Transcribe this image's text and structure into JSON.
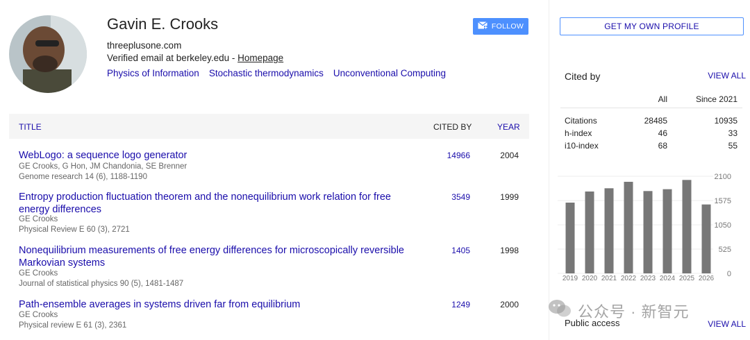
{
  "profile": {
    "name": "Gavin E. Crooks",
    "affiliation": "threeplusone.com",
    "email_text": "Verified email at berkeley.edu - ",
    "homepage_label": "Homepage",
    "interests": [
      "Physics of Information",
      "Stochastic thermodynamics",
      "Unconventional Computing"
    ],
    "follow_label": "FOLLOW"
  },
  "table": {
    "headers": {
      "title": "TITLE",
      "cited_by": "CITED BY",
      "year": "YEAR"
    },
    "rows": [
      {
        "title": "WebLogo: a sequence logo generator",
        "authors": "GE Crooks, G Hon, JM Chandonia, SE Brenner",
        "venue": "Genome research 14 (6), 1188-1190",
        "cited": "14966",
        "year": "2004"
      },
      {
        "title": "Entropy production fluctuation theorem and the nonequilibrium work relation for free energy differences",
        "authors": "GE Crooks",
        "venue": "Physical Review E 60 (3), 2721",
        "cited": "3549",
        "year": "1999"
      },
      {
        "title": "Nonequilibrium measurements of free energy differences for microscopically reversible Markovian systems",
        "authors": "GE Crooks",
        "venue": "Journal of statistical physics 90 (5), 1481-1487",
        "cited": "1405",
        "year": "1998"
      },
      {
        "title": "Path-ensemble averages in systems driven far from equilibrium",
        "authors": "GE Crooks",
        "venue": "Physical review E 61 (3), 2361",
        "cited": "1249",
        "year": "2000"
      }
    ]
  },
  "sidebar": {
    "own_profile_label": "GET MY OWN PROFILE",
    "cited_by_title": "Cited by",
    "view_all_label": "VIEW ALL",
    "stats_headers": {
      "all": "All",
      "since": "Since 2021"
    },
    "stats": [
      {
        "label": "Citations",
        "all": "28485",
        "since": "10935"
      },
      {
        "label": "h-index",
        "all": "46",
        "since": "33"
      },
      {
        "label": "i10-index",
        "all": "68",
        "since": "55"
      }
    ],
    "public_access_title": "Public access",
    "public_view_all_label": "VIEW ALL"
  },
  "watermark": {
    "text": "公众号 · 新智元",
    "icon": "wechat-icon"
  },
  "colors": {
    "link": "#1a0dab",
    "button": "#4d90fe",
    "bar": "#777777"
  },
  "chart_data": {
    "type": "bar",
    "categories": [
      "2019",
      "2020",
      "2021",
      "2022",
      "2023",
      "2024",
      "2025",
      "2026"
    ],
    "values": [
      1530,
      1770,
      1840,
      1980,
      1780,
      1820,
      2020,
      1490
    ],
    "yticks": [
      0,
      525,
      1050,
      1575,
      2100
    ],
    "ylim": [
      0,
      2100
    ],
    "grid": true
  }
}
